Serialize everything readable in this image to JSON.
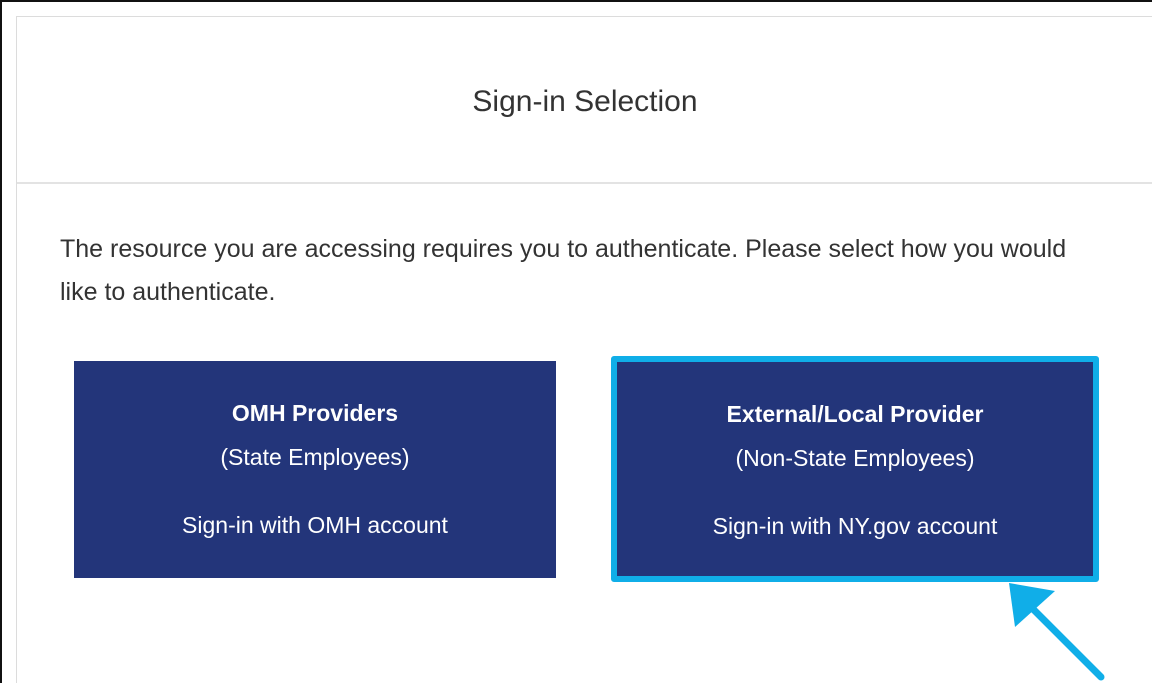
{
  "dialog": {
    "title": "Sign-in Selection",
    "instructions": "The resource you are accessing requires you to authenticate. Please select how you would like to authenticate."
  },
  "options": [
    {
      "title": "OMH Providers",
      "subtitle": "(State Employees)",
      "action": "Sign-in with OMH account"
    },
    {
      "title": "External/Local Provider",
      "subtitle": "(Non-State Employees)",
      "action": "Sign-in with NY.gov account"
    }
  ],
  "annotation": {
    "highlight_color": "#10aee8",
    "arrow_icon": "pointer-arrow-icon"
  },
  "colors": {
    "button_background": "#23357a",
    "button_text": "#ffffff",
    "title_text": "#333333"
  }
}
